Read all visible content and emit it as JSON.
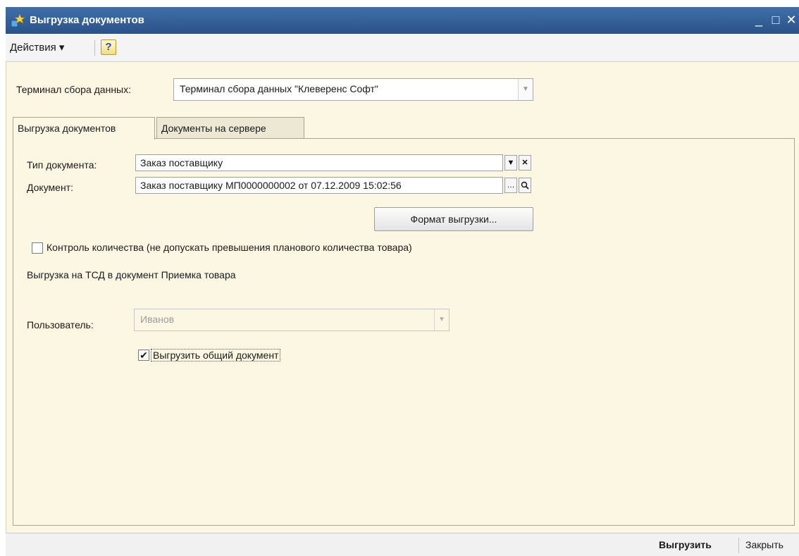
{
  "window": {
    "title": "Выгрузка документов",
    "minimize": "_",
    "maximize": "□",
    "close": "✕"
  },
  "toolbar": {
    "actions_label": "Действия ▾",
    "help_label": "?"
  },
  "terminal": {
    "label": "Терминал сбора данных:",
    "value": "Терминал сбора данных \"Клеверенс Софт\""
  },
  "tabs": [
    {
      "label": "Выгрузка документов",
      "active": true
    },
    {
      "label": "Документы на сервере",
      "active": false
    }
  ],
  "doc_type": {
    "label": "Тип документа:",
    "value": "Заказ поставщику"
  },
  "document": {
    "label": "Документ:",
    "value": "Заказ поставщику МП0000000002 от 07.12.2009 15:02:56"
  },
  "format_button": "Формат выгрузки...",
  "quantity_control": {
    "label": "Контроль количества (не допускать превышения планового количества товара)",
    "checked": false
  },
  "info_text": "Выгрузка на ТСД в документ Приемка товара",
  "user": {
    "label": "Пользователь:",
    "value": "Иванов"
  },
  "export_common": {
    "label": "Выгрузить общий документ",
    "checked": true
  },
  "footer": {
    "export_label": "Выгрузить",
    "close_label": "Закрыть"
  }
}
